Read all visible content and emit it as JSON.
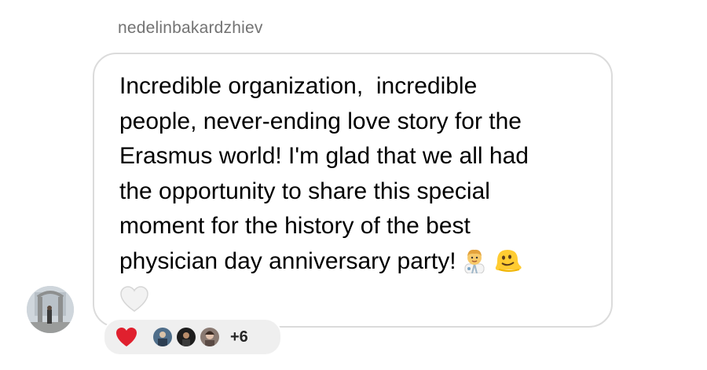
{
  "sender": {
    "username": "nedelinbakardzhiev"
  },
  "message": {
    "lines": [
      "Incredible organization,  incredible",
      "people, never-ending love story for the",
      "Erasmus world! I'm glad that we all had",
      "the opportunity to share this special",
      "moment for the history of the best",
      "physician day anniversary party!"
    ],
    "trailing_emojis": [
      "man-health-worker-emoji",
      "melting-face-emoji",
      "white-heart-emoji"
    ]
  },
  "reactions": {
    "primary": "red-heart-emoji",
    "reactor_avatars": 3,
    "more_count": "+6"
  },
  "colors": {
    "bubble_border": "#dbdbdb",
    "username": "#737373",
    "reaction_pill": "#efefef"
  }
}
